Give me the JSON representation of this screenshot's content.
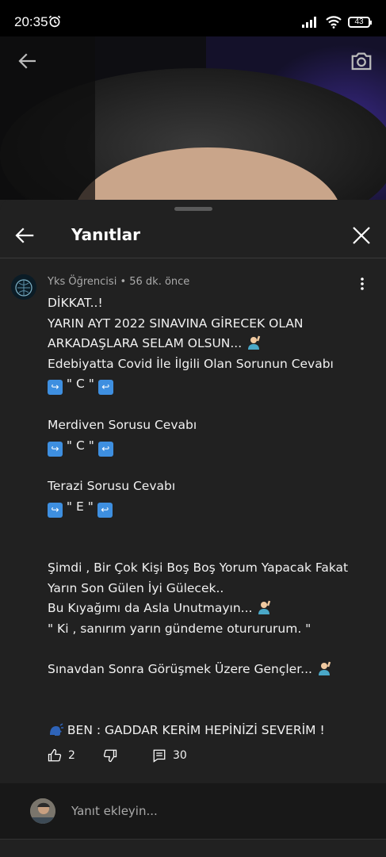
{
  "status_bar": {
    "time": "20:35",
    "battery": "43"
  },
  "panel": {
    "title": "Yanıtlar"
  },
  "comment": {
    "author": "Yks Öğrencisi",
    "time_ago": "56 dk. önce",
    "meta_sep": " • ",
    "lines": {
      "l1": "DİKKAT..!",
      "l2": "YARIN AYT 2022 SINAVINA GİRECEK OLAN",
      "l3": "ARKADAŞLARA SELAM OLSUN... ",
      "l4": "Edebiyatta Covid İle İlgili Olan Sorunun Cevabı",
      "l5": " \" C \" ",
      "l6": "Merdiven Sorusu Cevabı",
      "l7": " \" C \" ",
      "l8": "Terazi Sorusu Cevabı",
      "l9": " \" E \" ",
      "l10": "Şimdi , Bir Çok Kişi Boş Boş Yorum Yapacak Fakat",
      "l11": "Yarın Son Gülen İyi Gülecek..",
      "l12": "Bu Kıyağımı da Asla Unutmayın... ",
      "l13": "\" Ki , sanırım yarın gündeme oturururum. \"",
      "l14": "Sınavdan Sonra Görüşmek Üzere Gençler... ",
      "l15": " BEN : GADDAR KERİM HEPİNİZİ SEVERİM !"
    },
    "likes": "2",
    "replies": "30"
  },
  "reply_input": {
    "placeholder": "Yanıt ekleyin..."
  },
  "icons": {
    "back": "arrow-left-icon",
    "camera": "camera-icon",
    "close": "close-icon",
    "more": "more-vert-icon",
    "like": "thumb-up-icon",
    "dislike": "thumb-down-icon",
    "reply": "comment-icon"
  },
  "colors": {
    "background": "#212121",
    "accent_blue": "#3e8fe0",
    "muted": "#aaaaaa"
  }
}
